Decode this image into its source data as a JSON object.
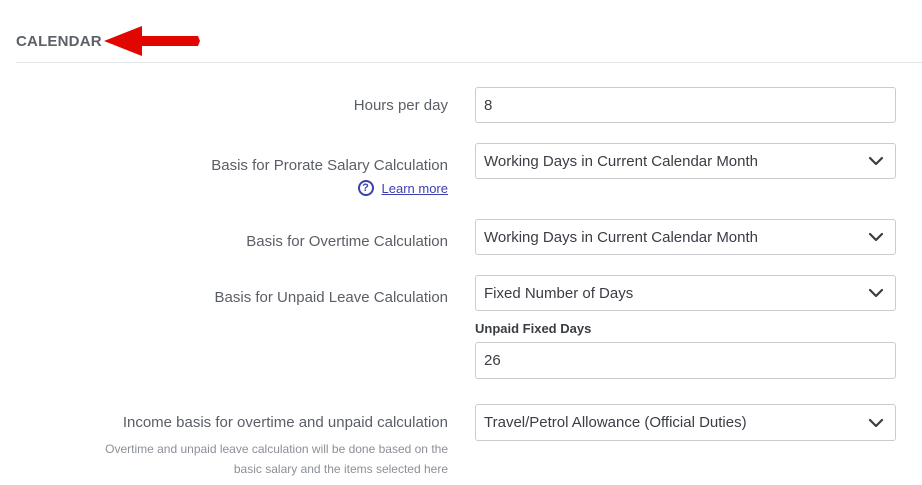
{
  "section": {
    "title": "CALENDAR"
  },
  "fields": {
    "hours_per_day": {
      "label": "Hours per day",
      "value": "8"
    },
    "prorate": {
      "label": "Basis for Prorate Salary Calculation",
      "value": "Working Days in Current Calendar Month",
      "learn_more": "Learn more"
    },
    "overtime": {
      "label": "Basis for Overtime Calculation",
      "value": "Working Days in Current Calendar Month"
    },
    "unpaid": {
      "label": "Basis for Unpaid Leave Calculation",
      "value": "Fixed Number of Days",
      "sublabel": "Unpaid Fixed Days",
      "subvalue": "26"
    },
    "income": {
      "label": "Income basis for overtime and unpaid calculation",
      "value": "Travel/Petrol Allowance (Official Duties)",
      "note_line1": "Overtime and unpaid leave calculation will be done based on the",
      "note_line2": "basic salary and the items selected here"
    }
  },
  "icons": {
    "arrow": "red-arrow-icon",
    "help": "question-circle-icon",
    "dropdown": "chevron-down-icon"
  },
  "colors": {
    "arrow": "#e10600",
    "link": "#3b3fb0",
    "border": "#c9ccd1"
  }
}
